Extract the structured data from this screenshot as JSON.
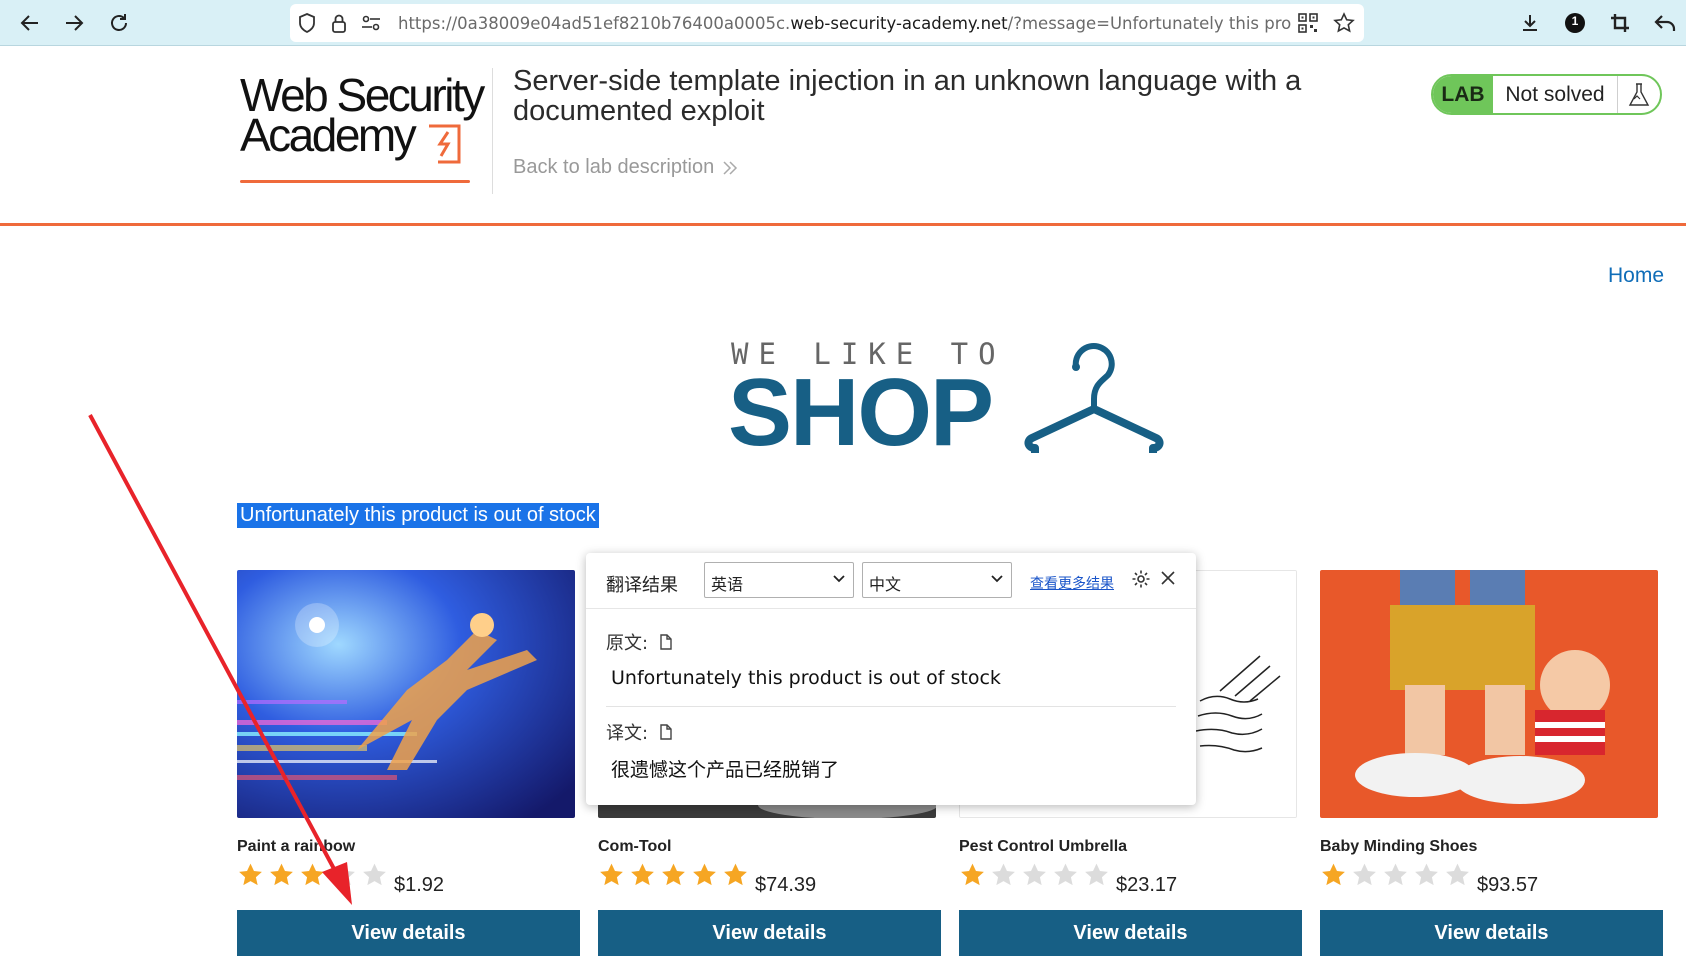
{
  "browser": {
    "url_prefix": "https://0a38009e04ad51ef8210b76400a0005c.",
    "url_host": "web-security-academy.net",
    "url_suffix": "/?message=Unfortunately this proc",
    "notification_count": "1"
  },
  "lab": {
    "logo_line1": "Web Security",
    "logo_line2": "Academy",
    "title": "Server-side template injection in an unknown language with a documented exploit",
    "back_link": "Back to lab description",
    "badge_label": "LAB",
    "status": "Not solved"
  },
  "shop": {
    "home_link": "Home",
    "hero_small": "WE LIKE TO",
    "hero_big": "SHOP",
    "message": "Unfortunately this product is out of stock",
    "products": [
      {
        "name": "Paint a rainbow",
        "price": "$1.92",
        "rating": 3,
        "button": "View details"
      },
      {
        "name": "Com-Tool",
        "price": "$74.39",
        "rating": 5,
        "button": "View details"
      },
      {
        "name": "Pest Control Umbrella",
        "price": "$23.17",
        "rating": 1,
        "button": "View details"
      },
      {
        "name": "Baby Minding Shoes",
        "price": "$93.57",
        "rating": 1,
        "button": "View details"
      }
    ]
  },
  "translate_popup": {
    "title": "翻译结果",
    "source_lang": "英语",
    "target_lang": "中文",
    "more_link": "查看更多结果",
    "original_label": "原文:",
    "original_text": "Unfortunately this product is out of stock",
    "translation_label": "译文:",
    "translation_text": "很遗憾这个产品已经脱销了"
  },
  "colors": {
    "accent_orange": "#ef6a3b",
    "shop_blue": "#175f85",
    "lab_green": "#6fc65a",
    "star_gold": "#f6a623",
    "star_empty": "#dcdcdc"
  }
}
